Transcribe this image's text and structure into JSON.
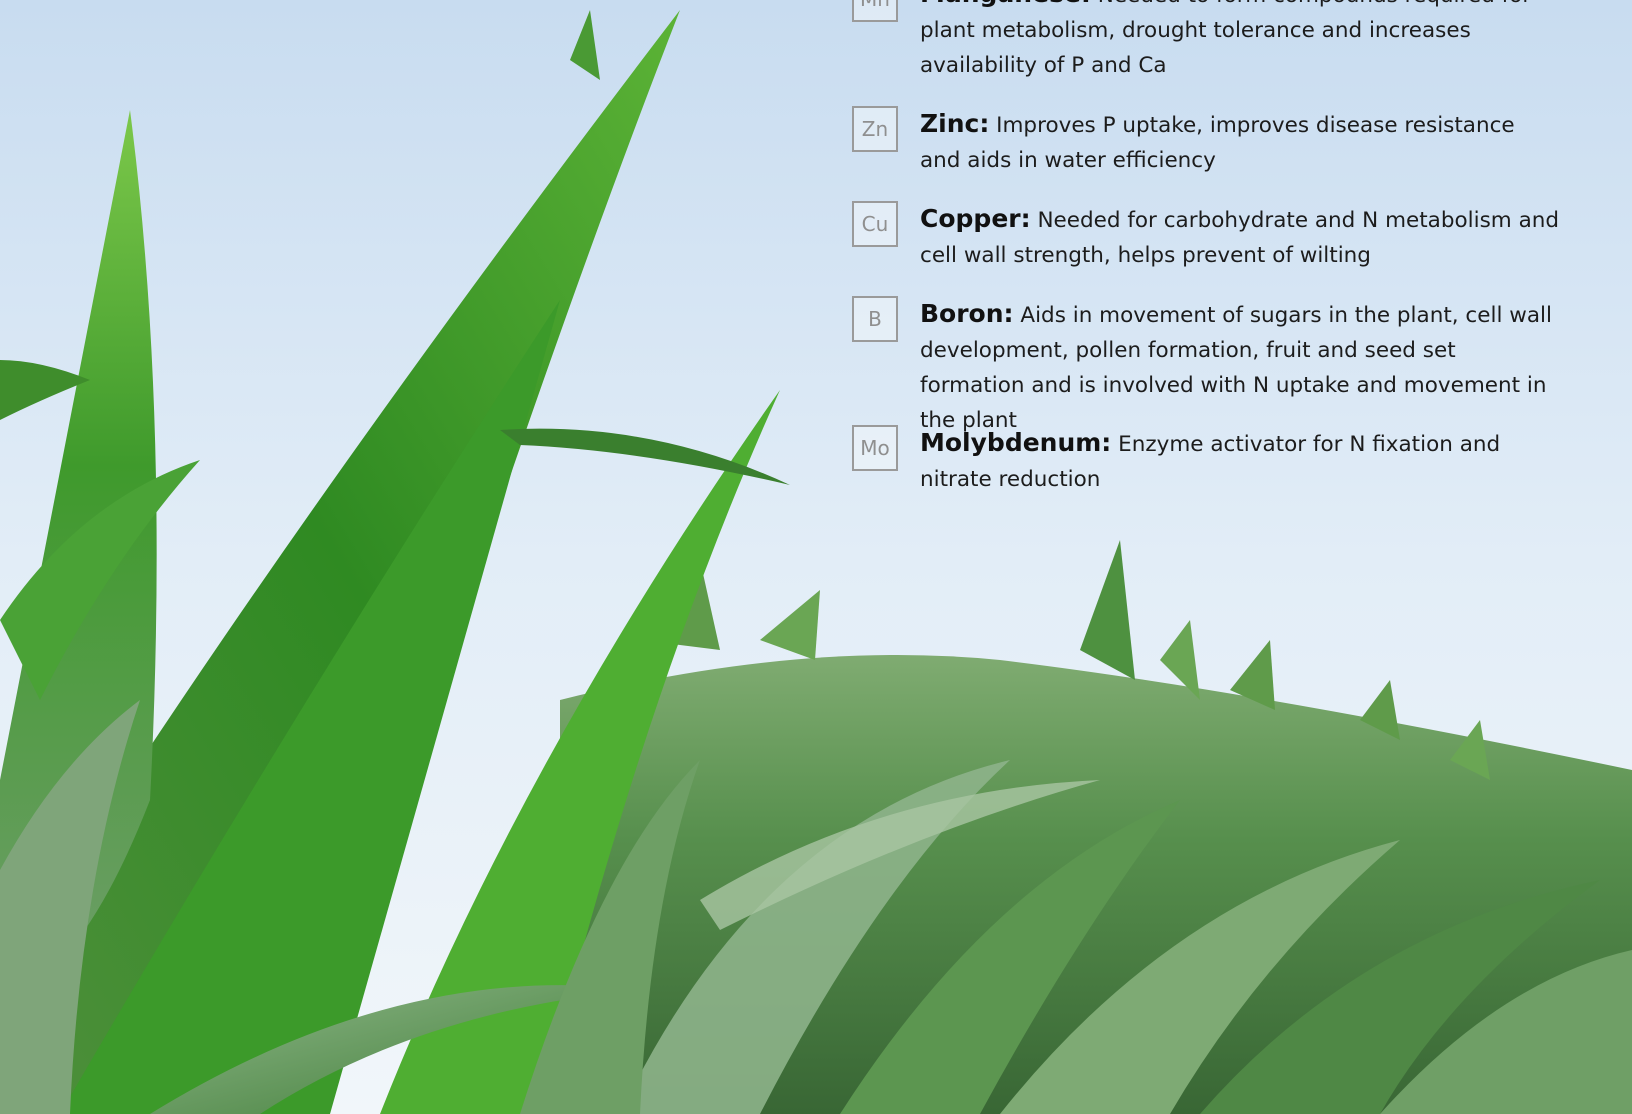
{
  "nutrients": [
    {
      "symbol": "Mn",
      "name": "Manganese:",
      "description": " Needed to form compounds required for plant metabolism, drought tolerance and increases availability of P and Ca"
    },
    {
      "symbol": "Zn",
      "name": "Zinc:",
      "description": " Improves P uptake, improves disease resistance and aids in water efficiency"
    },
    {
      "symbol": "Cu",
      "name": "Copper:",
      "description": " Needed for carbohydrate and N metabolism and cell wall strength, helps prevent of wilting"
    },
    {
      "symbol": "B",
      "name": "Boron:",
      "description": " Aids in movement of sugars in the plant, cell wall development, pollen formation, fruit and seed set formation and is involved with N uptake and movement in the plant"
    },
    {
      "symbol": "Mo",
      "name": "Molybdenum:",
      "description": " Enzyme activator for N fixation and nitrate reduction"
    }
  ],
  "colors": {
    "sky": "#dbe9f6",
    "leaf_dark": "#2e7d1f",
    "leaf_light": "#6cbf3a",
    "box_border": "#9a9a9a"
  }
}
